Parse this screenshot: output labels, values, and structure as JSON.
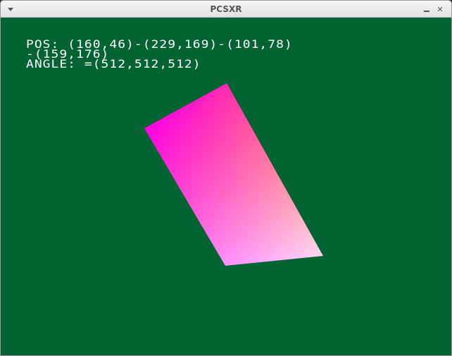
{
  "window": {
    "title": "PCSXR",
    "close_glyph": "✕"
  },
  "screen": {
    "background": "#046333",
    "text_color": "#ffffff",
    "lines": [
      "POS: (160,46)-(229,169)-(101,78)",
      "-(159,176)",
      "ANGLE: =(512,512,512)"
    ],
    "quad_vertex_colors": [
      "#ff0000",
      "#0000ff",
      "#ff00ff",
      "#00ff00"
    ]
  },
  "icons": {
    "menu": "window-menu-icon",
    "minimize": "minimize-icon",
    "close": "close-icon"
  }
}
